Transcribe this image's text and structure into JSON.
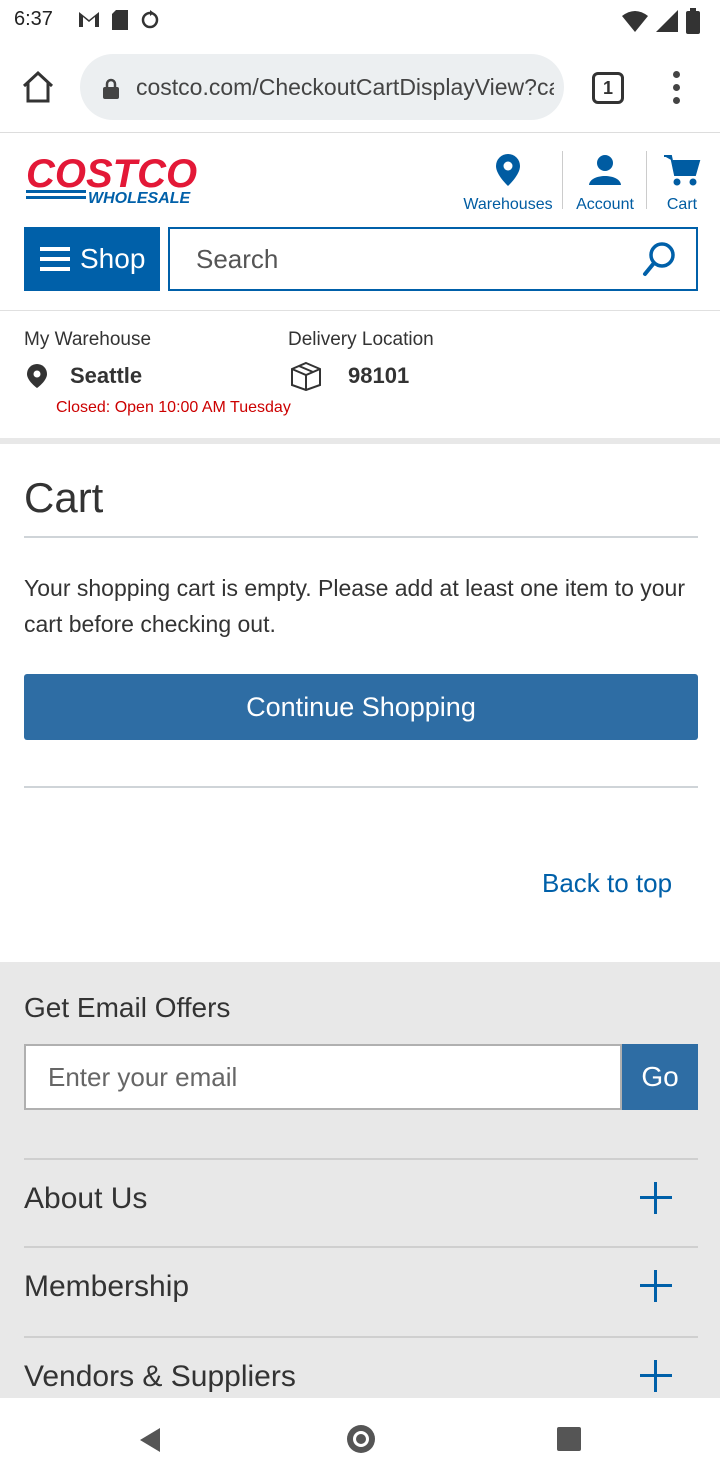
{
  "status_bar": {
    "time": "6:37"
  },
  "browser": {
    "url": "costco.com/CheckoutCartDisplayView?catal",
    "tab_count": "1"
  },
  "header": {
    "logo_text_top": "COSTCO",
    "logo_text_bottom": "WHOLESALE",
    "warehouses_label": "Warehouses",
    "account_label": "Account",
    "cart_label": "Cart",
    "shop_label": "Shop",
    "search_placeholder": "Search",
    "brand_color": "#e31837",
    "accent_color": "#0060a9"
  },
  "location": {
    "warehouse_heading": "My Warehouse",
    "warehouse_name": "Seattle",
    "warehouse_status": "Closed: Open 10:00 AM Tuesday",
    "delivery_heading": "Delivery Location",
    "delivery_zip": "98101"
  },
  "cart": {
    "title": "Cart",
    "empty_message": "Your shopping cart is empty. Please add at least one item to your cart before checking out.",
    "continue_label": "Continue Shopping",
    "back_to_top": "Back to top"
  },
  "footer": {
    "email_heading": "Get Email Offers",
    "email_placeholder": "Enter your email",
    "go_label": "Go",
    "sections": [
      {
        "label": "About Us"
      },
      {
        "label": "Membership"
      },
      {
        "label": "Vendors & Suppliers"
      }
    ]
  }
}
